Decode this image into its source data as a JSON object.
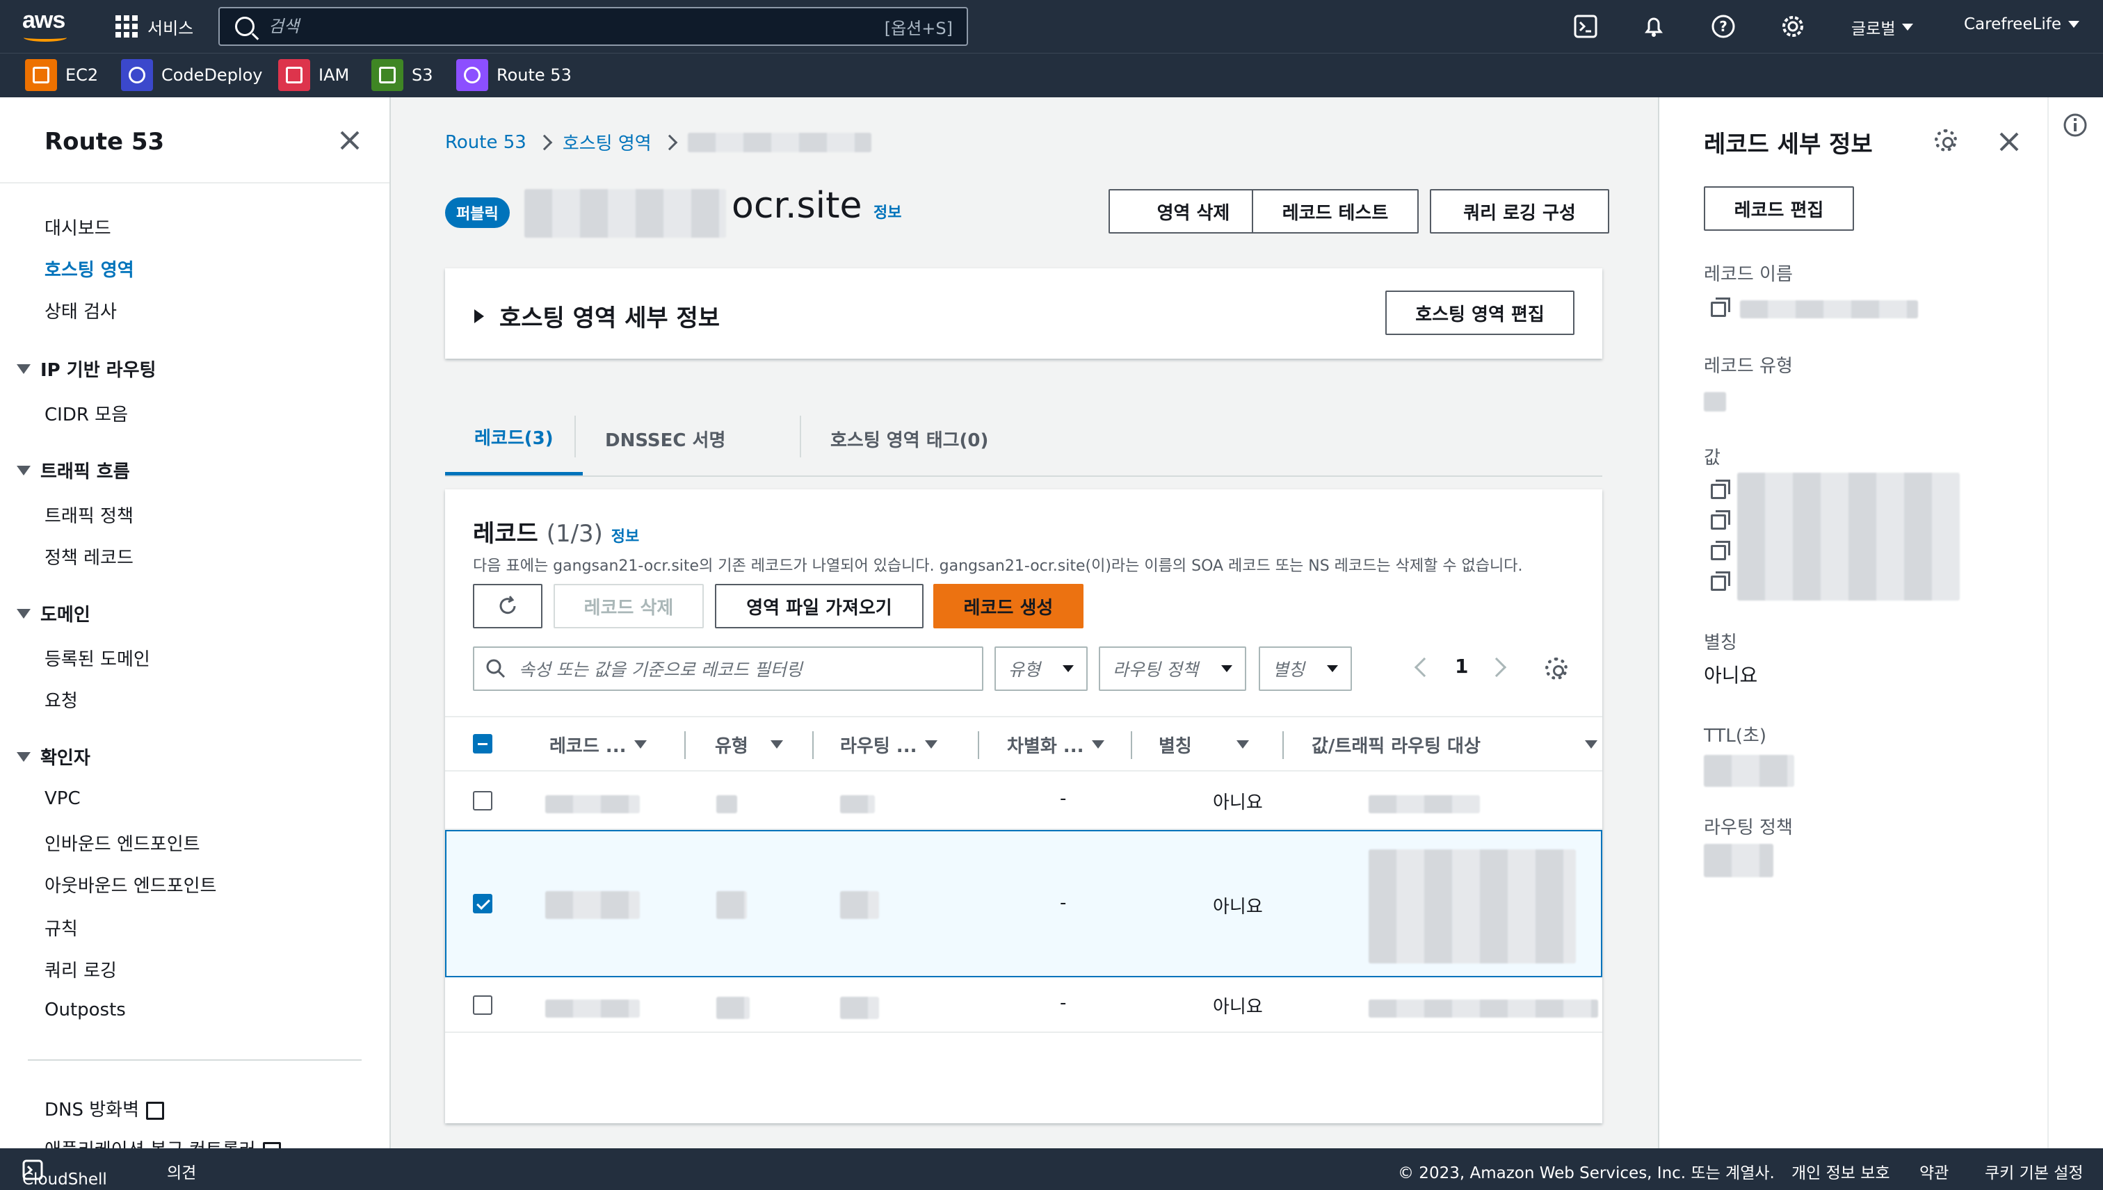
{
  "topnav": {
    "logo": "aws",
    "services_label": "서비스",
    "search_placeholder": "검색",
    "search_shortcut": "[옵션+S]",
    "region": "글로벌",
    "account": "CarefreeLife"
  },
  "favorites": [
    {
      "label": "EC2",
      "color": "#ed7100"
    },
    {
      "label": "CodeDeploy",
      "color": "#3b48cc"
    },
    {
      "label": "IAM",
      "color": "#dd344c"
    },
    {
      "label": "S3",
      "color": "#3f8624"
    },
    {
      "label": "Route 53",
      "color": "#8c4fff"
    }
  ],
  "sidebar": {
    "title": "Route 53",
    "items": {
      "dashboard": "대시보드",
      "hosted_zones": "호스팅 영역",
      "health_checks": "상태 검사",
      "ip_routing": "IP 기반 라우팅",
      "cidr": "CIDR 모음",
      "traffic_flow": "트래픽 흐름",
      "traffic_policy": "트래픽 정책",
      "policy_records": "정책 레코드",
      "domains": "도메인",
      "registered_domains": "등록된 도메인",
      "requests": "요청",
      "resolver": "확인자",
      "vpc": "VPC",
      "inbound": "인바운드 엔드포인트",
      "outbound": "아웃바운드 엔드포인트",
      "rules": "규칙",
      "query_logging": "쿼리 로깅",
      "outposts": "Outposts",
      "dns_firewall": "DNS 방화벽",
      "app_recovery": "애플리케이션 복구 컨트롤러"
    }
  },
  "breadcrumb": {
    "root": "Route 53",
    "hosted_zones": "호스팅 영역"
  },
  "zone": {
    "badge": "퍼블릭",
    "name_suffix": "ocr.site",
    "info": "정보",
    "btn_delete_zone": "영역 삭제",
    "btn_test_record": "레코드 테스트",
    "btn_query_logging": "쿼리 로깅 구성",
    "details_title": "호스팅 영역 세부 정보",
    "btn_edit_zone": "호스팅 영역 편집"
  },
  "tabs": [
    "레코드(3)",
    "DNSSEC 서명",
    "호스팅 영역 태그(0)"
  ],
  "records": {
    "title": "레코드",
    "count": "(1/3)",
    "info": "정보",
    "description": "다음 표에는 gangsan21-ocr.site의 기존 레코드가 나열되어 있습니다. gangsan21-ocr.site(이)라는 이름의 SOA 레코드 또는 NS 레코드는 삭제할 수 없습니다.",
    "btn_delete": "레코드 삭제",
    "btn_import": "영역 파일 가져오기",
    "btn_create": "레코드 생성",
    "filter_placeholder": "속성 또는 값을 기준으로 레코드 필터링",
    "filter_type": "유형",
    "filter_routing": "라우팅 정책",
    "filter_alias": "별칭",
    "page": "1",
    "columns": [
      "레코드 ...",
      "유형",
      "라우팅 ...",
      "차별화 ...",
      "별칭",
      "값/트래픽 라우팅 대상"
    ],
    "rows": [
      {
        "diff": "-",
        "alias": "아니요",
        "selected": false
      },
      {
        "diff": "-",
        "alias": "아니요",
        "selected": true
      },
      {
        "diff": "-",
        "alias": "아니요",
        "selected": false
      }
    ]
  },
  "detail_panel": {
    "title": "레코드 세부 정보",
    "btn_edit": "레코드 편집",
    "label_name": "레코드 이름",
    "label_type": "레코드 유형",
    "label_value": "값",
    "label_alias": "별칭",
    "alias_value": "아니요",
    "label_ttl": "TTL(초)",
    "label_routing": "라우팅 정책"
  },
  "footer": {
    "cloudshell": "CloudShell",
    "feedback": "의견",
    "copyright": "© 2023, Amazon Web Services, Inc. 또는 계열사.",
    "privacy": "개인 정보 보호",
    "terms": "약관",
    "cookies": "쿠키 기본 설정"
  }
}
